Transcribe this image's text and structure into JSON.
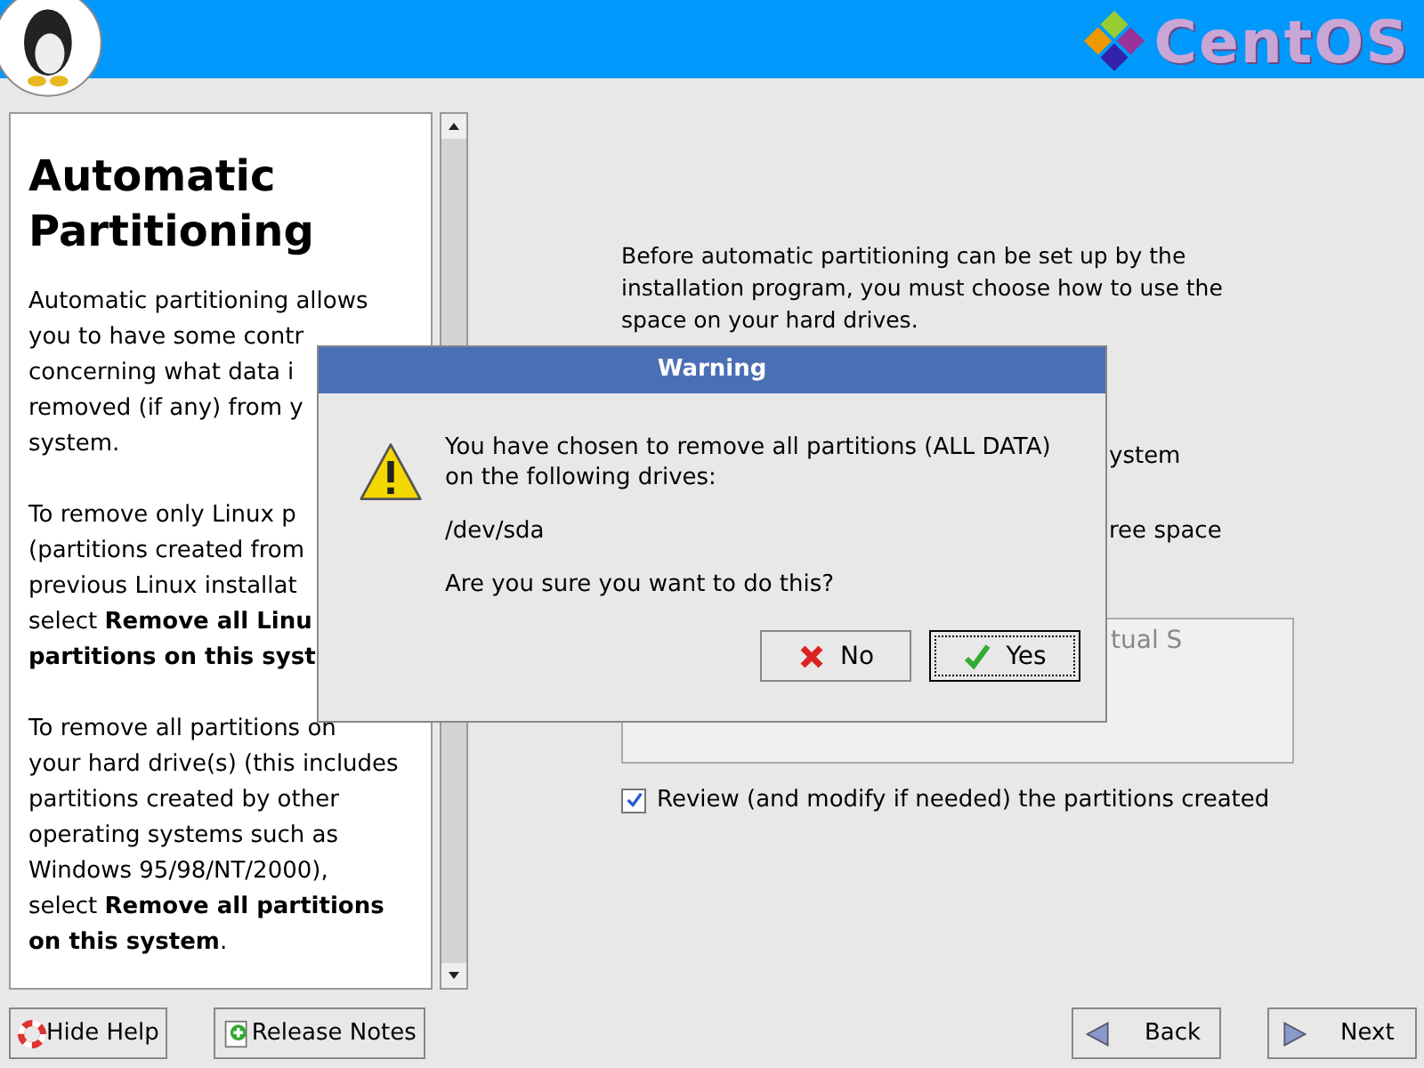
{
  "header": {
    "brand": "CentOS"
  },
  "help": {
    "title": "Automatic Partitioning",
    "paragraphs": [
      [
        "Automatic partitioning allows",
        "you to have some contr",
        "concerning what data i",
        "removed (if any) from y",
        "system."
      ],
      [
        "To remove only Linux p",
        "(partitions created from",
        "previous Linux installat",
        "select **Remove all Linu**",
        "**partitions on this syst**"
      ],
      [
        "To remove all partitions on",
        "your hard drive(s) (this includes",
        "partitions created by other",
        "operating systems such as",
        "Windows 95/98/NT/2000),",
        "select **Remove all partitions**",
        "**on this system**."
      ]
    ]
  },
  "main": {
    "intro": "Before automatic partitioning can be set up by the installation program, you must choose how to use the space on your hard drives.",
    "option_fragments": [
      "ystem",
      "ree space"
    ],
    "drive_list_fragment": "tual S",
    "review": {
      "label": "Review (and modify if needed) the partitions created",
      "checked": true
    }
  },
  "dialog": {
    "title": "Warning",
    "message": "You have chosen to remove all partitions (ALL DATA) on the following drives:",
    "drive": "/dev/sda",
    "question": "Are you sure you want to do this?",
    "buttons": [
      {
        "kind": "no",
        "label": "No",
        "focused": false
      },
      {
        "kind": "yes",
        "label": "Yes",
        "focused": true
      }
    ]
  },
  "footer": {
    "left": [
      {
        "kind": "help",
        "label": "Hide Help"
      },
      {
        "kind": "notes",
        "label": "Release Notes"
      }
    ],
    "right": [
      {
        "kind": "back",
        "label": "Back"
      },
      {
        "kind": "next",
        "label": "Next"
      }
    ]
  }
}
